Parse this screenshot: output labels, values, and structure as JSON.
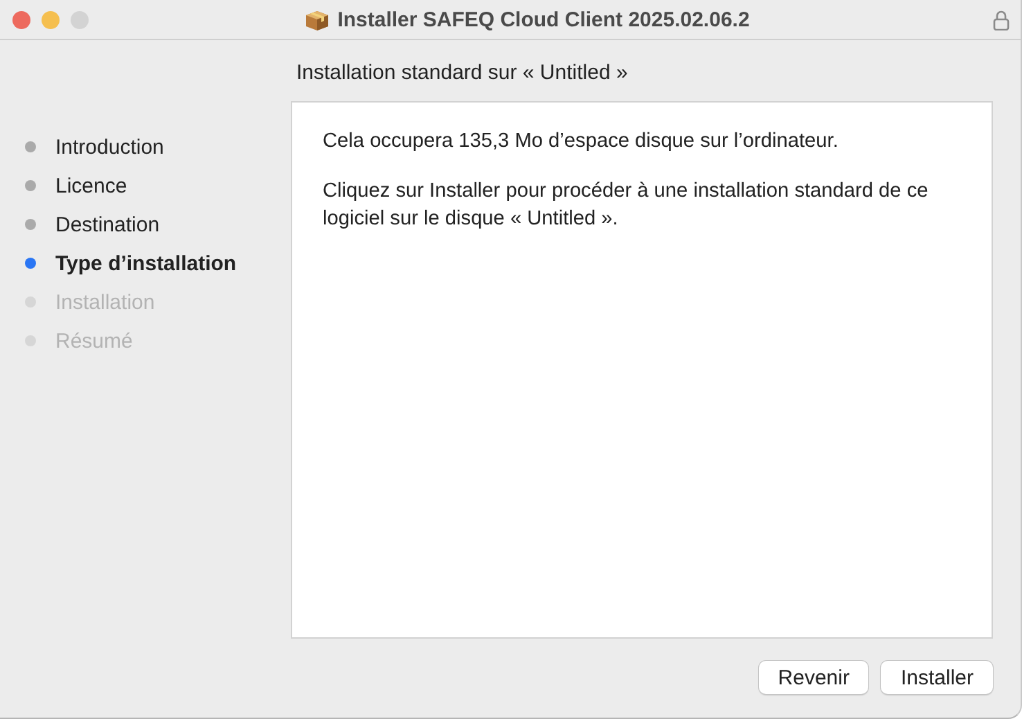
{
  "window": {
    "title": "Installer SAFEQ Cloud Client 2025.02.06.2"
  },
  "heading": "Installation standard sur « Untitled »",
  "steps": [
    {
      "label": "Introduction",
      "selected": false,
      "disabled": false
    },
    {
      "label": "Licence",
      "selected": false,
      "disabled": false
    },
    {
      "label": "Destination",
      "selected": false,
      "disabled": false
    },
    {
      "label": "Type d’installation",
      "selected": true,
      "disabled": false
    },
    {
      "label": "Installation",
      "selected": false,
      "disabled": true
    },
    {
      "label": "Résumé",
      "selected": false,
      "disabled": true
    }
  ],
  "content": [
    "Cela occupera 135,3 Mo d’espace disque sur l’ordinateur.",
    "Cliquez sur Installer pour procéder à une installation standard de ce logiciel sur le disque « Untitled »."
  ],
  "buttons": [
    "Revenir",
    "Installer"
  ]
}
